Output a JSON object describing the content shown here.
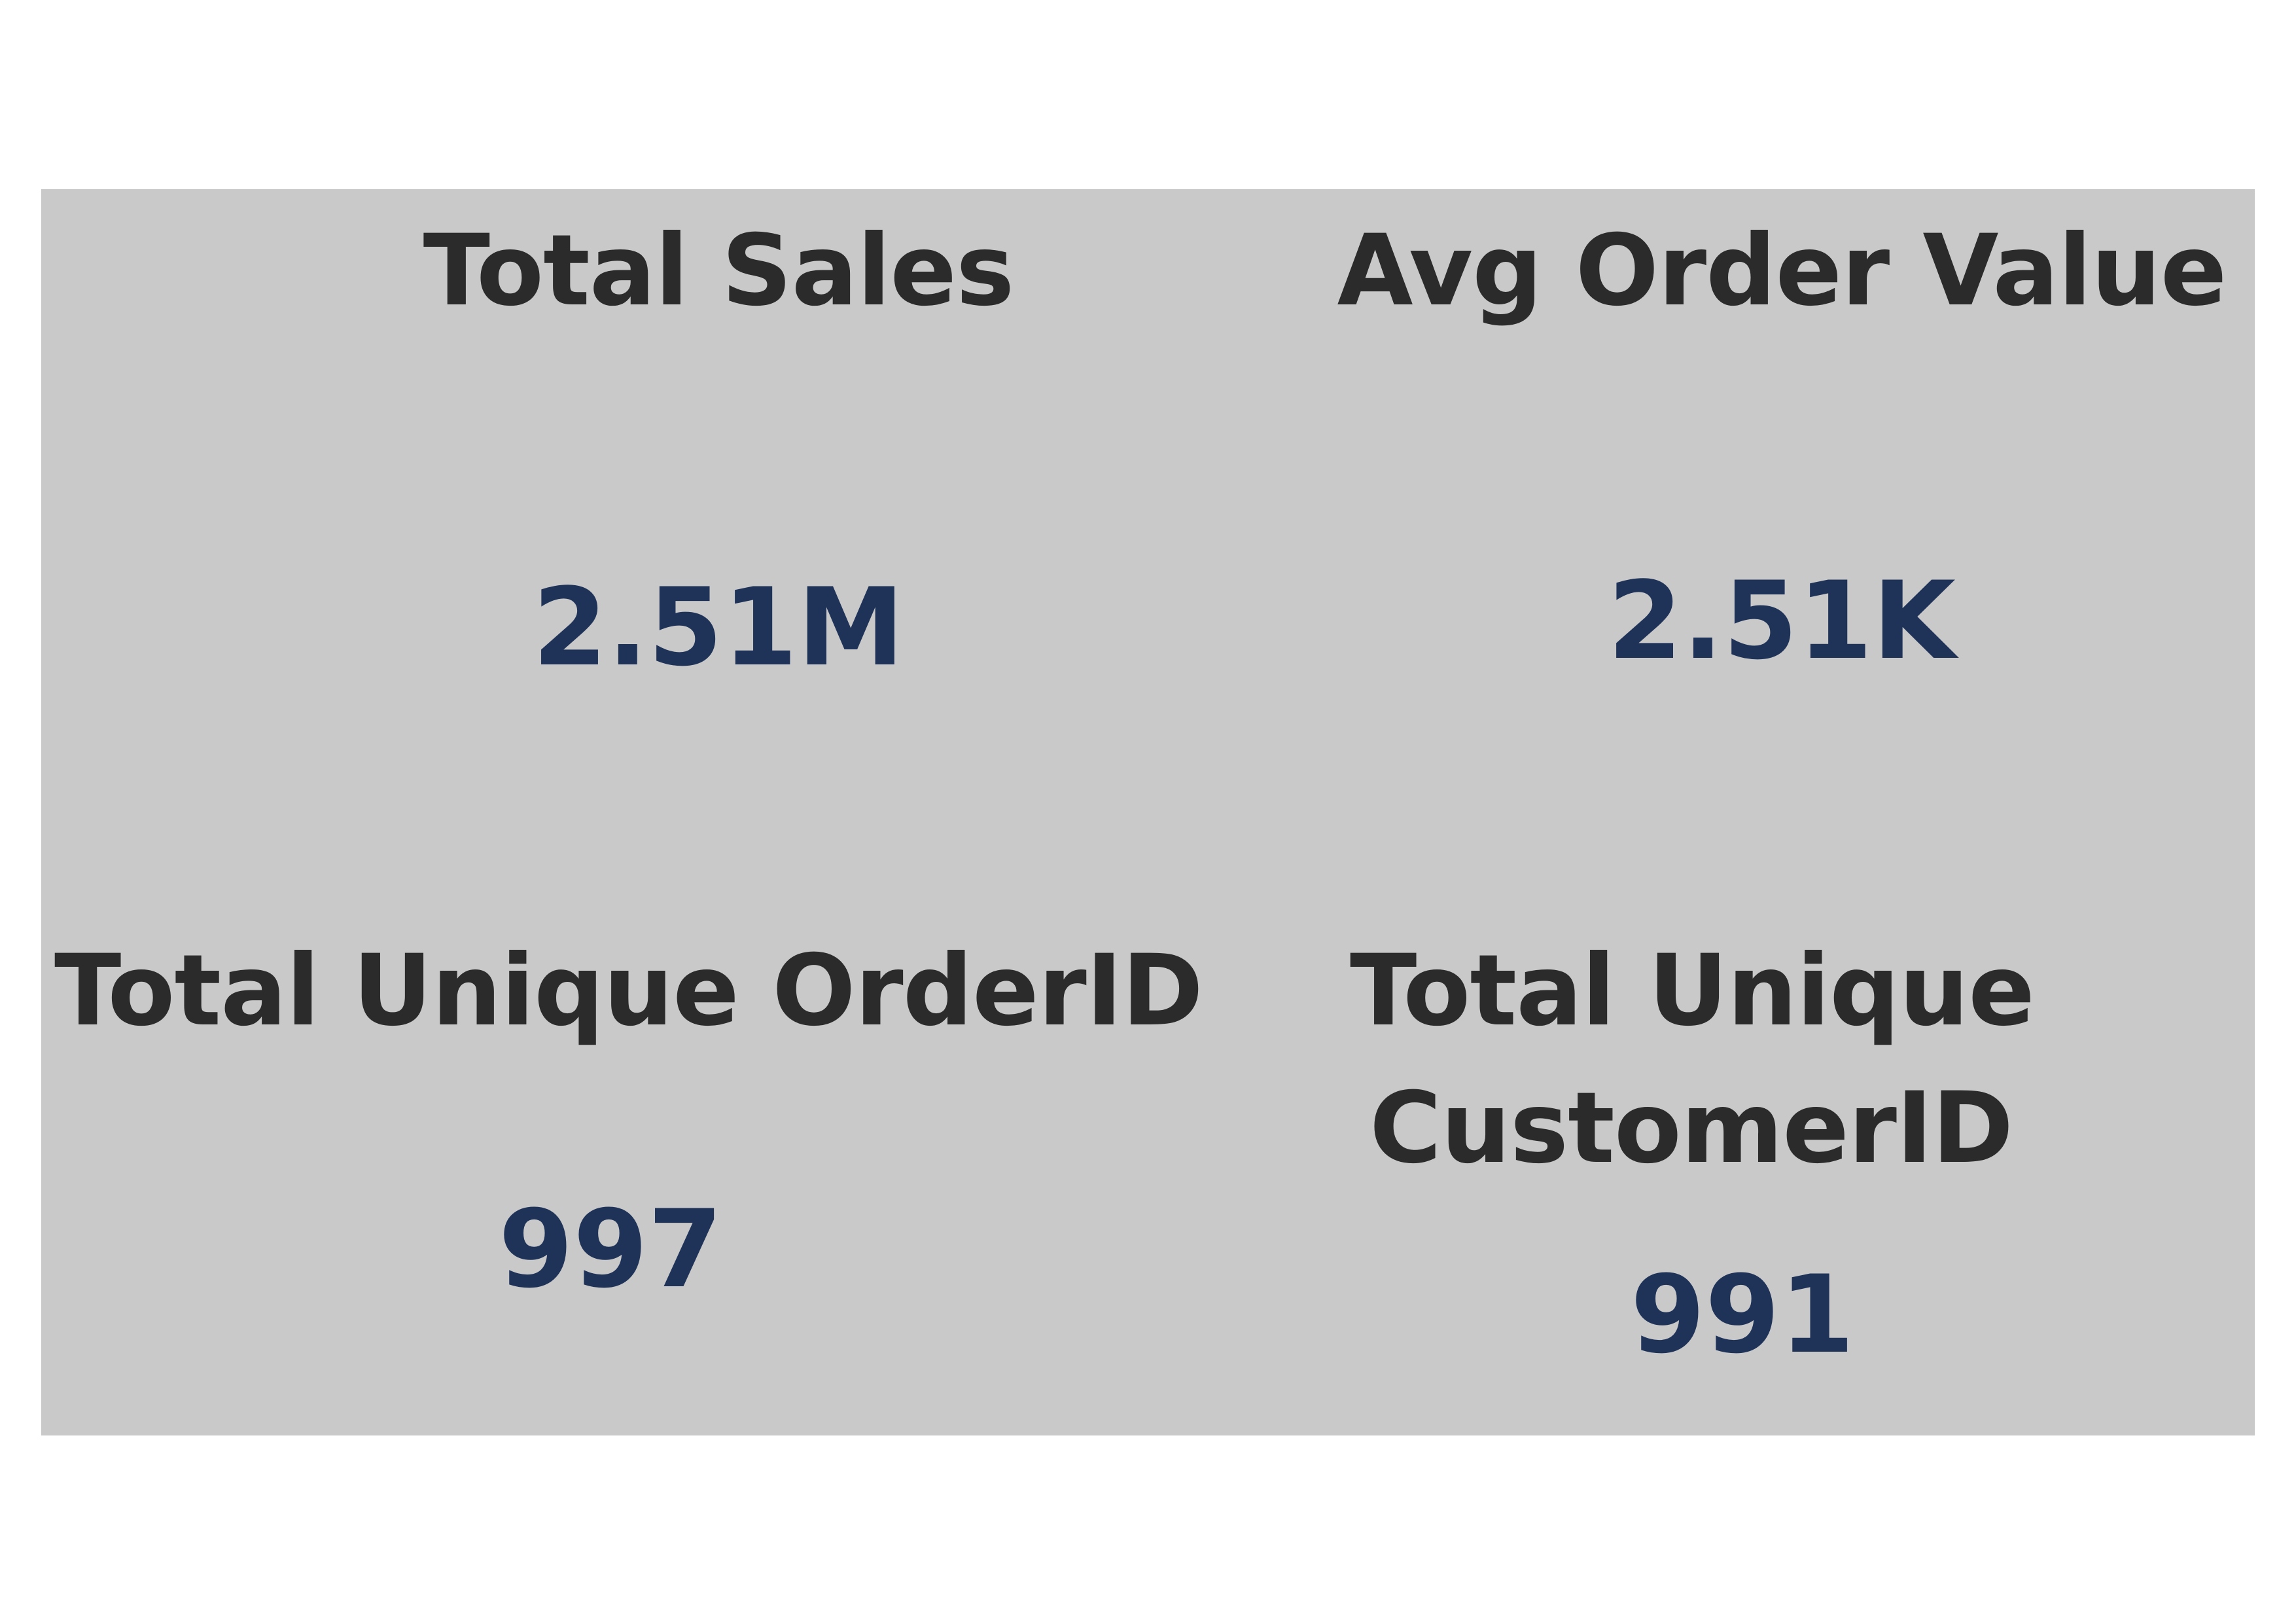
{
  "cards": [
    {
      "title": "Total Sales",
      "value": "2.51M"
    },
    {
      "title": "Avg Order Value",
      "value": "2.51K"
    },
    {
      "title": "Total Unique OrderID",
      "value": "997"
    },
    {
      "title_line1": "Total Unique",
      "title_line2": "CustomerID",
      "value": "991"
    }
  ],
  "colors": {
    "panel_background": "#c9c9c9",
    "title_text": "#2b2b2b",
    "value_text": "#1f3359"
  }
}
